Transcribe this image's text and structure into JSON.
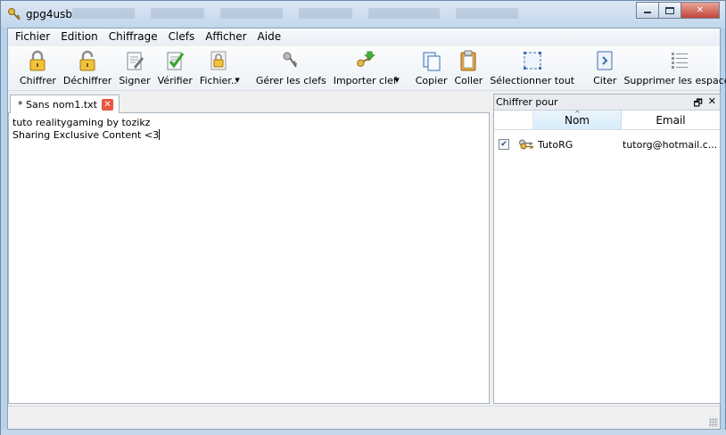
{
  "window": {
    "title": "gpg4usb"
  },
  "menu": [
    "Fichier",
    "Edition",
    "Chiffrage",
    "Clefs",
    "Afficher",
    "Aide"
  ],
  "toolbar": {
    "chiffrer": "Chiffrer",
    "dechiffrer": "Déchiffrer",
    "signer": "Signer",
    "verifier": "Vérifier",
    "fichier": "Fichier..",
    "gerer": "Gérer les clefs",
    "importer": "Importer clef",
    "copier": "Copier",
    "coller": "Coller",
    "selectionner": "Sélectionner tout",
    "citer": "Citer",
    "supprimer": "Supprimer les espaces"
  },
  "tab": {
    "label": "* Sans nom1.txt"
  },
  "editor": {
    "lines": [
      "tuto realitygaming by tozikz",
      "Sharing Exclusive Content <3"
    ]
  },
  "dock": {
    "title": "Chiffrer pour",
    "columns": {
      "nom": "Nom",
      "email": "Email"
    },
    "keys": [
      {
        "checked": true,
        "nom": "TutoRG",
        "email": "tutorg@hotmail.c..."
      }
    ]
  }
}
